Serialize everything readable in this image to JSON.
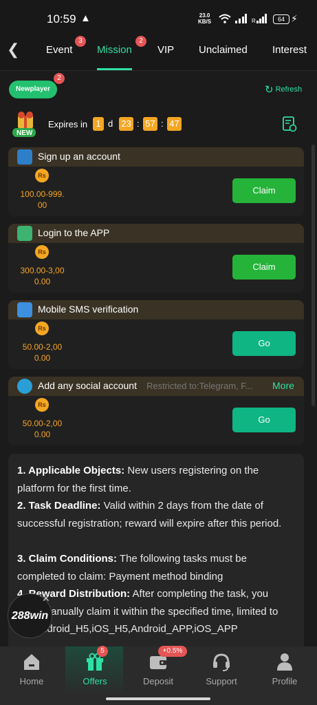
{
  "status_bar": {
    "time": "10:59",
    "net_speed_top": "23.0",
    "net_speed_bottom": "KB/S",
    "battery": "64"
  },
  "tabs": [
    {
      "label": "Event",
      "badge": "3"
    },
    {
      "label": "Mission",
      "badge": "2",
      "active": true
    },
    {
      "label": "VIP"
    },
    {
      "label": "Unclaimed"
    },
    {
      "label": "Interest"
    }
  ],
  "newplayer": {
    "label": "Newplayer",
    "badge": "2"
  },
  "refresh_label": "Refresh",
  "expires": {
    "label": "Expires in",
    "days": "1",
    "day_unit": "d",
    "hours": "23",
    "minutes": "57",
    "seconds": "47",
    "sep": ":",
    "new_tag": "NEW"
  },
  "currency_symbol": "Rs",
  "missions": [
    {
      "title": "Sign up an account",
      "reward_line1": "100.00-999.",
      "reward_line2": "00",
      "button": "Claim",
      "button_type": "claim"
    },
    {
      "title": "Login to the APP",
      "reward_line1": "300.00-3,00",
      "reward_line2": "0.00",
      "button": "Claim",
      "button_type": "claim"
    },
    {
      "title": "Mobile SMS verification",
      "reward_line1": "50.00-2,00",
      "reward_line2": "0.00",
      "button": "Go",
      "button_type": "go"
    },
    {
      "title": "Add any social account",
      "restriction": "Restricted to:Telegram, F...",
      "more": "More",
      "reward_line1": "50.00-2,00",
      "reward_line2": "0.00",
      "button": "Go",
      "button_type": "go"
    }
  ],
  "rules": {
    "r1_title": "1. Applicable Objects:",
    "r1_text": " New users registering on the platform for the first time.",
    "r2_title": "2. Task Deadline:",
    "r2_text": " Valid within 2 days from the date of successful registration; reward will expire after this period.",
    "r3_title": "3. Claim Conditions:",
    "r3_text": " The following tasks must be completed to claim: Payment method binding",
    "r4_title": "4. Reward Distribution:",
    "r4_text": " After completing the task, you must manually claim it within the specified time, limited to PC,Android_H5,iOS_H5,Android_APP,iOS_APP"
  },
  "float_logo": "288win",
  "bottom_nav": [
    {
      "label": "Home",
      "icon": "home-icon"
    },
    {
      "label": "Offers",
      "icon": "gift-icon",
      "badge": "5",
      "active": true
    },
    {
      "label": "Deposit",
      "icon": "wallet-icon",
      "badge": "+0.5%"
    },
    {
      "label": "Support",
      "icon": "headset-icon"
    },
    {
      "label": "Profile",
      "icon": "person-icon"
    }
  ],
  "colors": {
    "accent": "#2fe0a4",
    "claim": "#25b33a",
    "go": "#10b584",
    "reward": "#f5a623",
    "badge": "#e55555"
  }
}
